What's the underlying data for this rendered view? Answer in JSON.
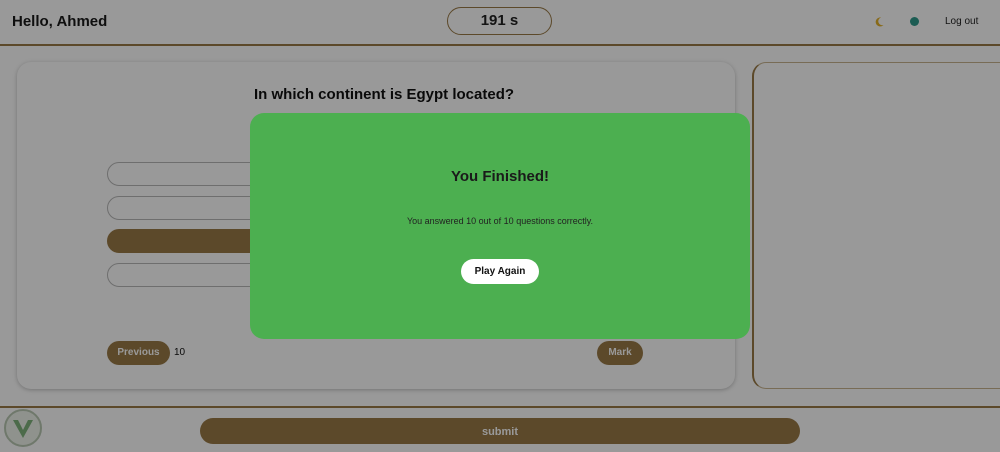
{
  "header": {
    "greeting": "Hello, Ahmed",
    "timer": "191 s",
    "theme_icon": "moon-icon",
    "language_icon": "globe-icon",
    "logout_label": "Log out"
  },
  "quiz": {
    "question": "In which continent is Egypt located?",
    "options": [
      "",
      "",
      "",
      ""
    ],
    "selected_option_index": 2,
    "previous_label": "Previous",
    "page_number": "10",
    "mark_label": "Mark"
  },
  "footer": {
    "submit_label": "submit",
    "logo_icon": "logo-icon"
  },
  "modal": {
    "title": "You Finished!",
    "message": "You answered 10 out of 10 questions correctly.",
    "play_again_label": "Play Again"
  },
  "colors": {
    "accent": "#9a7a46",
    "modal_background": "#4caf50",
    "overlay": "rgba(0,0,0,0.4)"
  }
}
